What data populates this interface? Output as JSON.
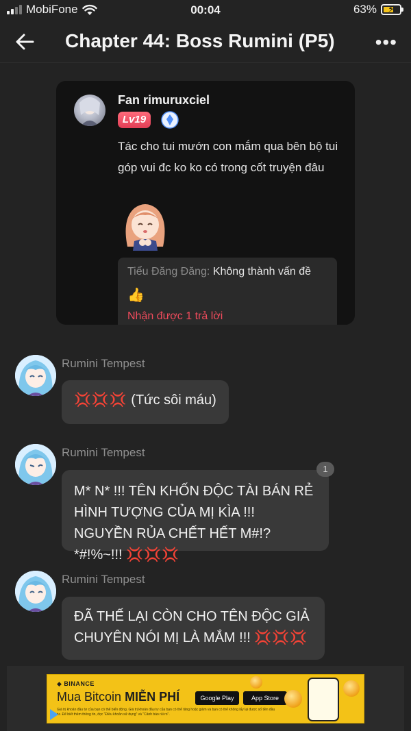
{
  "status_bar": {
    "carrier": "MobiFone",
    "time": "00:04",
    "battery": "63%",
    "battery_level": 0.63
  },
  "header": {
    "title": "Chapter 44: Boss Rumini (P5)"
  },
  "comment_card": {
    "author": "Fan rimuruxciel",
    "level": "Lv19",
    "text": "Tác cho tui mướn con mắm qua bên bộ tui góp vui đc ko ko có trong cốt truyện đâu",
    "reply": {
      "author": "Tiểu Đăng Đăng:",
      "text": "Không thành vấn đề",
      "emoji": "👍",
      "more": "Nhận được 1 trả lời"
    }
  },
  "messages": [
    {
      "name": "Rumini Tempest",
      "text": "(Tức sôi máu)",
      "emoji": "💢💢💢"
    },
    {
      "name": "Rumini Tempest",
      "text": "M* N* !!! TÊN KHỐN ĐỘC TÀI BÁN RẺ HÌNH TƯỢNG CỦA MỊ KÌA !!! NGUYỀN RỦA CHẾT HẾT M#!?*#!%~!!!",
      "emoji": "💢💢💢",
      "count": "1"
    },
    {
      "name": "Rumini Tempest",
      "text": "ĐÃ THẾ LẠI CÒN CHO TÊN ĐỘC GIẢ CHUYÊN NÓI MỊ LÀ MẮM !!!",
      "emoji": "💢💢💢"
    }
  ],
  "ad": {
    "brand": "BINANCE",
    "title_prefix": "Mua Bitcoin",
    "title_bold": "MIỄN PHÍ",
    "store_google": "Google Play",
    "store_apple": "App Store",
    "disclaimer": "Giá trị khoản đầu tư của bạn có thể biến động. Giá trị khoản đầu tư của bạn có thể tăng hoặc giảm và bạn có thể không lấy lại được số tiền đầu tư. Để biết thêm thông tin, đọc \"Điều khoản sử dụng\" và \"Cảnh báo rủi ro\"."
  },
  "colors": {
    "background": "#232323",
    "card": "#121212",
    "bubble": "#393939",
    "level_badge": "#e13d55",
    "reply_link": "#ef4b5c",
    "ad_yellow": "#f3c217"
  }
}
